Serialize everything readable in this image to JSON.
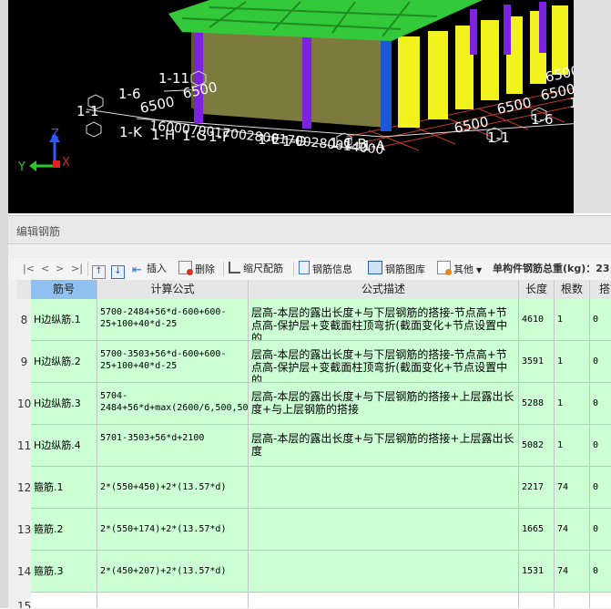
{
  "viewport": {
    "labels_left": [
      "1-11",
      "1-6",
      "6500",
      "1-1",
      "6500",
      "1-K",
      "1-H",
      "1-G",
      "1-F",
      "1-E",
      "1-D",
      "1-C",
      "1-B",
      "1-A"
    ],
    "dims_left": "16000700170028001700280014000",
    "labels_right": [
      "1-11",
      "6500",
      "6500",
      "6500",
      "1-6",
      "6500",
      "1-1"
    ],
    "axis": {
      "z": "Z",
      "y": "Y",
      "x": "X"
    }
  },
  "panel": {
    "title": "编辑钢筋"
  },
  "toolbar": {
    "nav_first": "|<",
    "nav_prev": "<",
    "nav_next": ">",
    "nav_last": ">|",
    "insert": "插入",
    "delete": "删除",
    "scale": "缩尺配筋",
    "info": "钢筋信息",
    "library": "钢筋图库",
    "other": "其他",
    "total_label": "单构件钢筋总重(kg)：23"
  },
  "columns": [
    "筋号",
    "计算公式",
    "公式描述",
    "长度",
    "根数",
    "搭"
  ],
  "rows": [
    {
      "num": "8",
      "name": "H边纵筋.1",
      "formula": "5700-2484+56*d-600+600-25+100+40*d-25",
      "desc": "层高-本层的露出长度+与下层钢筋的搭接-节点高+节点高-保护层+变截面柱顶弯折(截面变化+节点设置中的…",
      "length": "4610",
      "count": "1",
      "lap": "0"
    },
    {
      "num": "9",
      "name": "H边纵筋.2",
      "formula": "5700-3503+56*d-600+600-25+100+40*d-25",
      "desc": "层高-本层的露出长度+与下层钢筋的搭接-节点高+节点高-保护层+变截面柱顶弯折(截面变化+节点设置中的…",
      "length": "3591",
      "count": "1",
      "lap": "0"
    },
    {
      "num": "10",
      "name": "H边纵筋.3",
      "formula": "5704-2484+56*d+max(2600/6,500,500)+56*14",
      "desc": "层高-本层的露出长度+与下层钢筋的搭接+上层露出长度+与上层钢筋的搭接",
      "length": "5288",
      "count": "1",
      "lap": "0"
    },
    {
      "num": "11",
      "name": "H边纵筋.4",
      "formula": "5701-3503+56*d+2100",
      "desc": "层高-本层的露出长度+与下层钢筋的搭接+上层露出长度",
      "length": "5082",
      "count": "1",
      "lap": "0"
    },
    {
      "num": "12",
      "name": "箍筋.1",
      "formula": "2*(550+450)+2*(13.57*d)",
      "desc": "",
      "length": "2217",
      "count": "74",
      "lap": "0"
    },
    {
      "num": "13",
      "name": "箍筋.2",
      "formula": "2*(550+174)+2*(13.57*d)",
      "desc": "",
      "length": "1665",
      "count": "74",
      "lap": "0"
    },
    {
      "num": "14",
      "name": "箍筋.3",
      "formula": "2*(450+207)+2*(13.57*d)",
      "desc": "",
      "length": "1531",
      "count": "74",
      "lap": "0"
    },
    {
      "num": "15",
      "name": "",
      "formula": "",
      "desc": "",
      "length": "",
      "count": "",
      "lap": ""
    }
  ]
}
